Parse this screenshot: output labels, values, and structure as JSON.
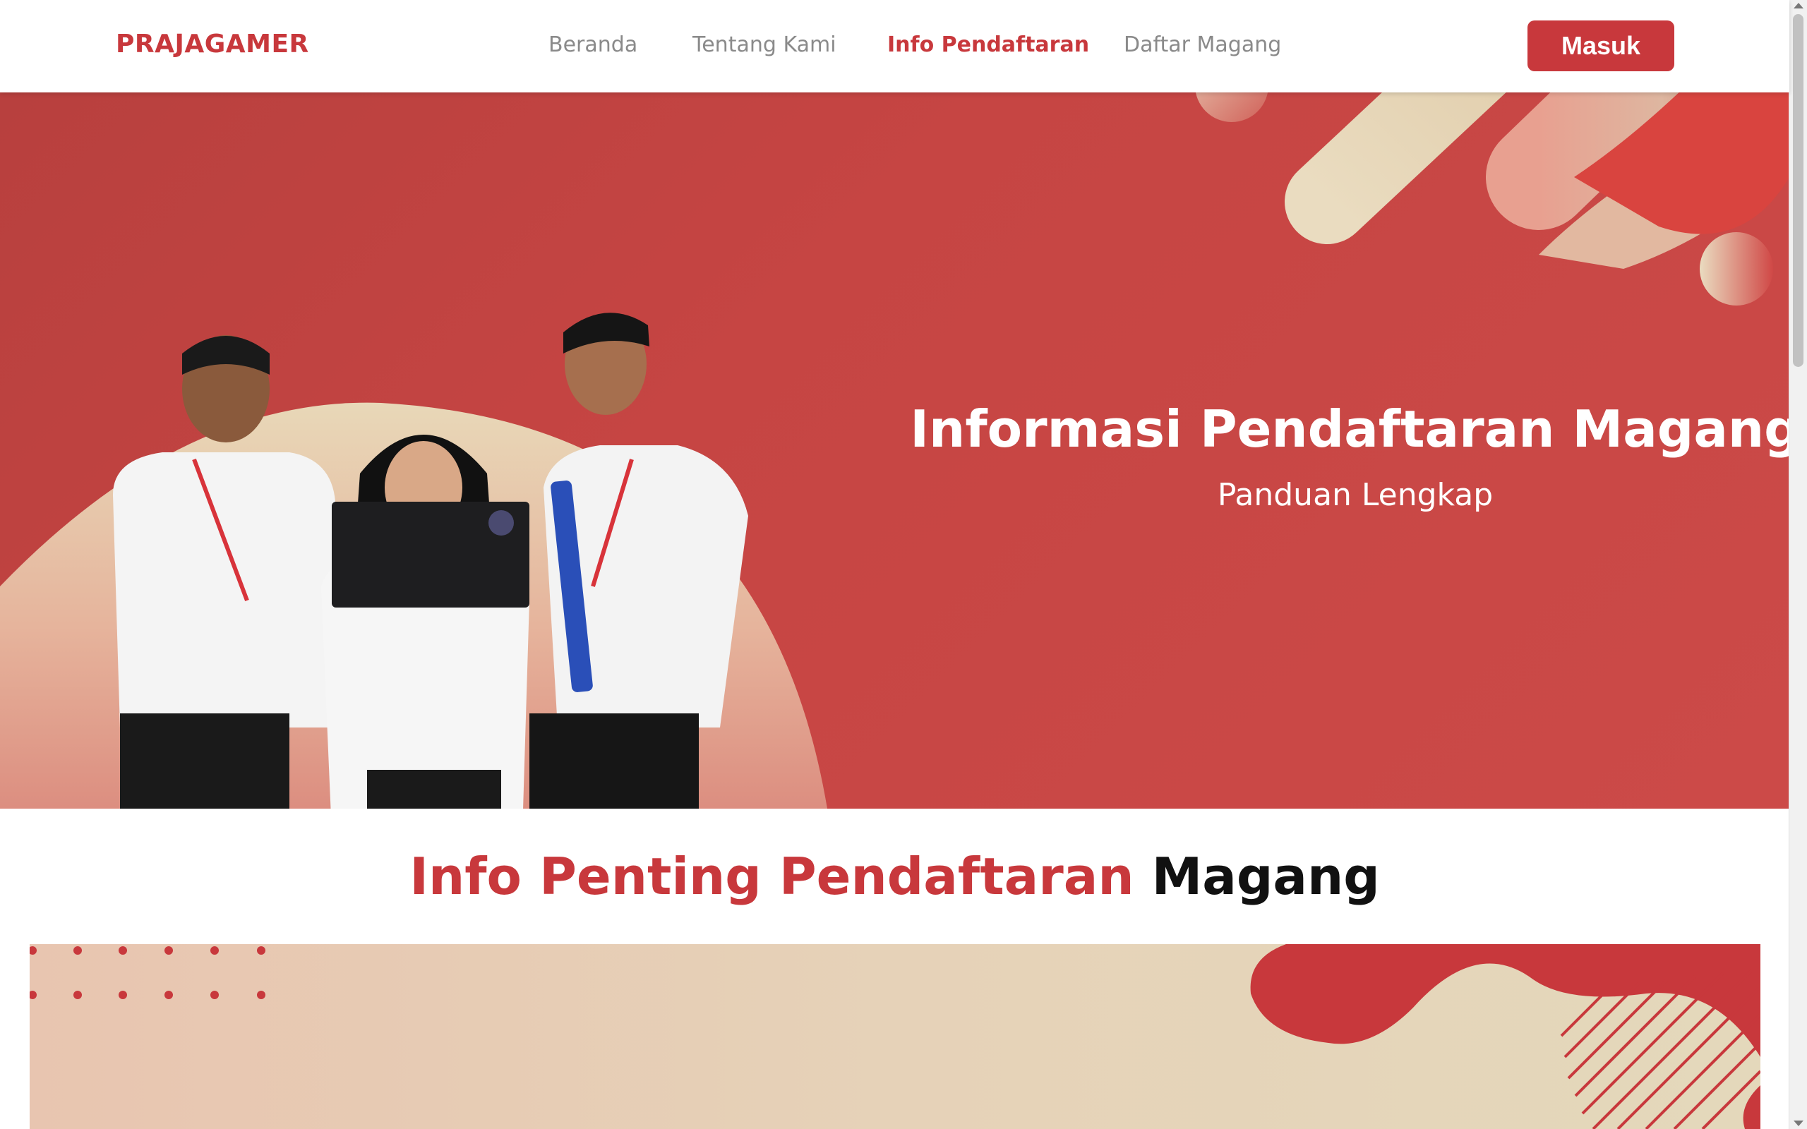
{
  "brand": {
    "name": "PRAJAGAMER",
    "color": "#c8383c"
  },
  "nav": {
    "items": [
      {
        "label": "Beranda",
        "active": false
      },
      {
        "label": "Tentang Kami",
        "active": false
      },
      {
        "label": "Info Pendaftaran",
        "active": true
      },
      {
        "label": "Daftar Magang",
        "active": false
      }
    ],
    "login_label": "Masuk"
  },
  "hero": {
    "title": "Informasi Pendaftaran Magang",
    "subtitle": "Panduan Lengkap",
    "image_icon": "students-photo"
  },
  "section": {
    "title_accent": "Info Penting Pendaftaran",
    "title_rest": "Magang"
  },
  "colors": {
    "primary": "#c8383c",
    "cream": "#e6d5b8",
    "peach": "#e8b4a0"
  }
}
